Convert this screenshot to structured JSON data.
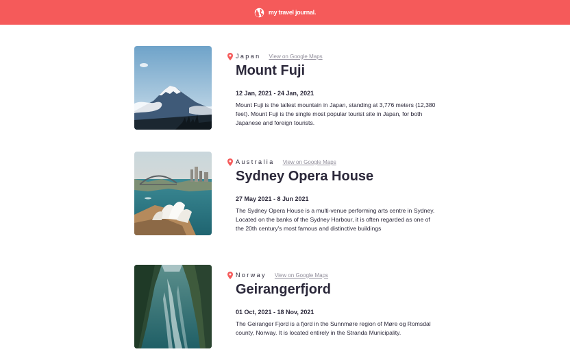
{
  "header": {
    "brand": "my travel journal.",
    "color": "#f55a5a"
  },
  "entries": [
    {
      "country": "Japan",
      "maps_link": "View on Google Maps",
      "title": "Mount Fuji",
      "dates": "12 Jan, 2021 - 24 Jan, 2021",
      "description": "Mount Fuji is the tallest mountain in Japan, standing at 3,776 meters (12,380 feet). Mount Fuji is the single most popular tourist site in Japan, for both Japanese and foreign tourists."
    },
    {
      "country": "Australia",
      "maps_link": "View on Google Maps",
      "title": "Sydney Opera House",
      "dates": "27 May 2021 - 8 Jun 2021",
      "description": "The Sydney Opera House is a multi-venue performing arts centre in Sydney. Located on the banks of the Sydney Harbour, it is often regarded as one of the 20th century's most famous and distinctive buildings"
    },
    {
      "country": "Norway",
      "maps_link": "View on Google Maps",
      "title": "Geirangerfjord",
      "dates": "01 Oct, 2021 - 18 Nov, 2021",
      "description": "The Geiranger Fjord is a fjord in the Sunnmøre region of Møre og Romsdal county, Norway. It is located entirely in the Stranda Municipality."
    }
  ],
  "icons": {
    "brand": "globe-icon",
    "location": "location-pin-icon"
  }
}
